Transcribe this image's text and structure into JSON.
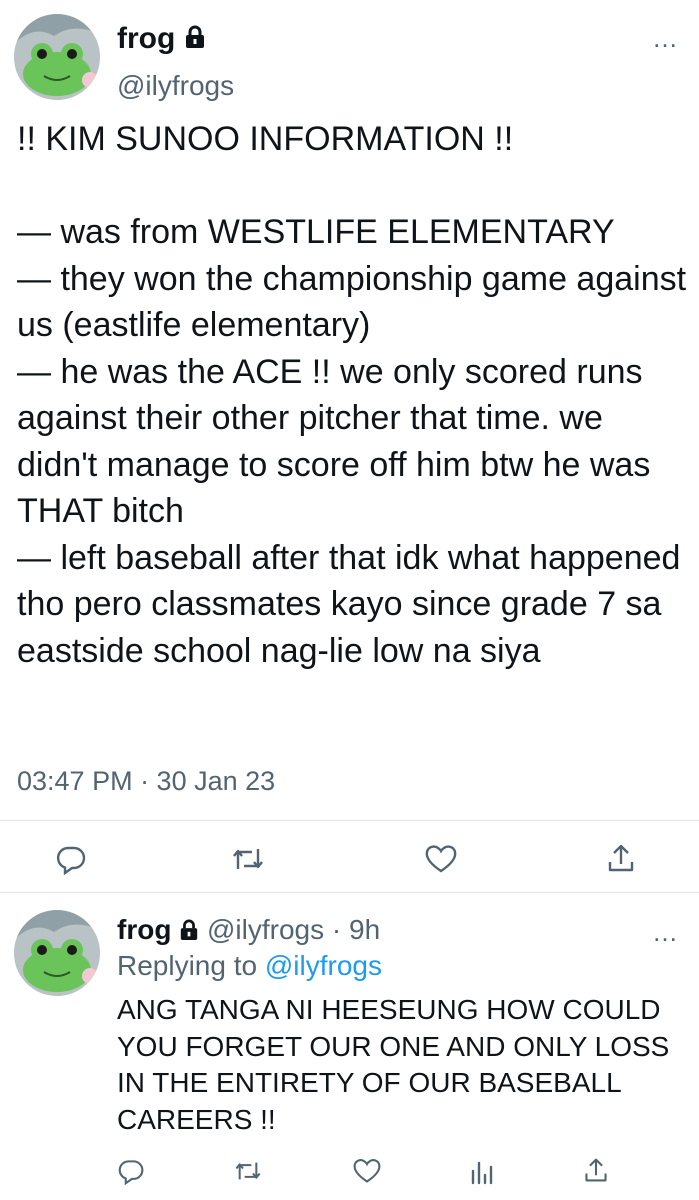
{
  "tweet": {
    "display_name": "frog",
    "handle": "@ilyfrogs",
    "text": "!! KIM SUNOO INFORMATION !!\n\n— was from WESTLIFE ELEMENTARY\n— they won the championship game against us (eastlife elementary)\n— he was the ACE !! we only scored runs against their other pitcher that time. we didn't manage to score off him btw he was THAT bitch\n— left baseball after that idk what happened tho pero classmates kayo since grade 7 sa eastside school nag-lie low na siya",
    "timestamp": "03:47 PM · 30 Jan 23",
    "more_icon": "…",
    "actions": [
      "reply-icon",
      "retweet-icon",
      "like-icon",
      "share-icon"
    ]
  },
  "reply": {
    "display_name": "frog",
    "handle_time": "@ilyfrogs · 9h",
    "replying_prefix": "Replying to",
    "replying_handle": "@ilyfrogs",
    "text": "ANG TANGA NI HEESEUNG HOW COULD YOU FORGET OUR ONE AND ONLY LOSS IN THE ENTIRETY OF OUR BASEBALL CAREERS !!",
    "more_icon": "…",
    "actions": [
      "reply-icon",
      "retweet-icon",
      "like-icon",
      "views-icon",
      "share-icon"
    ]
  },
  "colors": {
    "text": "#0f1419",
    "secondary": "#536471",
    "link": "#1d9bf0",
    "divider": "#e3e7ea"
  }
}
